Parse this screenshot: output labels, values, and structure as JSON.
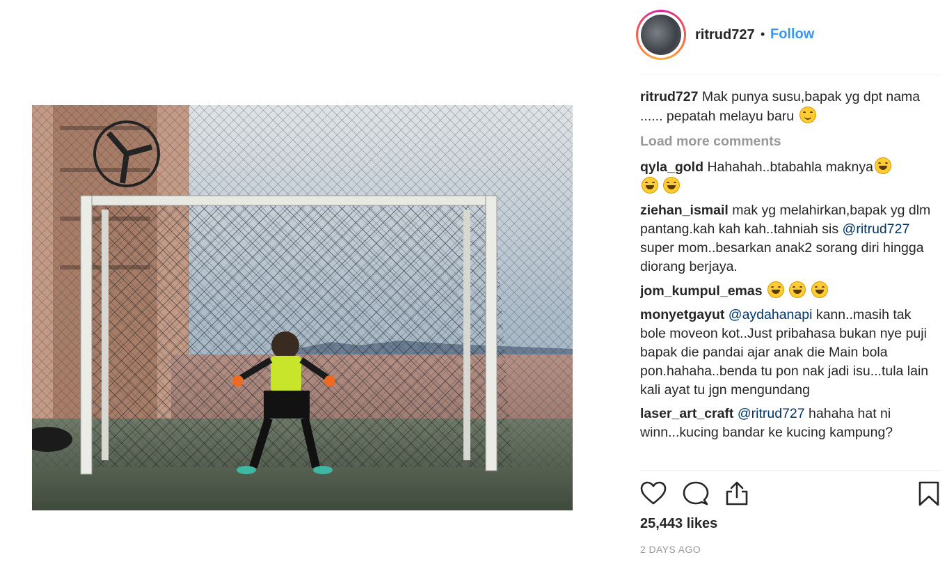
{
  "post": {
    "username": "ritrud727",
    "separator": "•",
    "follow_label": "Follow",
    "caption_user": "ritrud727",
    "caption_text": "Mak punya susu,bapak yg dpt nama ...... pepatah melayu baru",
    "load_more_label": "Load more comments",
    "likes": "25,443 likes",
    "timestamp": "2 DAYS AGO"
  },
  "comments": [
    {
      "user": "qyla_gold",
      "text": "Hahahah..btabahla maknya"
    },
    {
      "user": "ziehan_ismail",
      "text_before": "mak yg melahirkan,bapak yg dlm pantang.kah kah kah..tahniah sis ",
      "mention": "@ritrud727",
      "text_after": " super mom..besarkan anak2 sorang diri hingga diorang berjaya."
    },
    {
      "user": "jom_kumpul_emas",
      "text": ""
    },
    {
      "user": "monyetgayut",
      "mention": "@aydahanapi",
      "text_after": " kann..masih tak bole moveon kot..Just pribahasa bukan nye puji bapak die pandai ajar anak die Main bola pon.hahaha..benda tu pon nak jadi isu...tula lain kali ayat tu jgn mengundang"
    },
    {
      "user": "laser_art_craft",
      "mention": "@ritrud727",
      "text_after": " hahaha hat ni winn...kucing bandar ke kucing kampung?"
    }
  ],
  "icons": {
    "like": "heart-icon",
    "comment": "comment-bubble-icon",
    "share": "share-icon",
    "save": "bookmark-icon"
  },
  "colors": {
    "link": "#3897f0",
    "mention": "#003569",
    "muted": "#999999",
    "text": "#262626"
  }
}
